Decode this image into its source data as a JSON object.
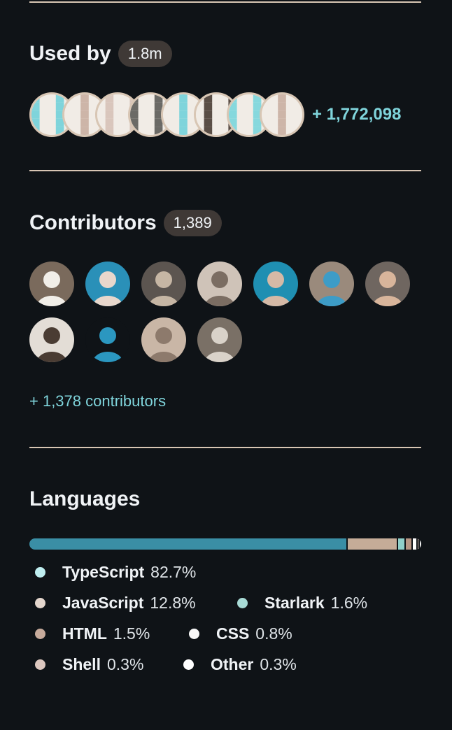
{
  "used_by": {
    "title": "Used by",
    "count": "1.8m",
    "more": "+ 1,772,098",
    "avatars": [
      {
        "fg": "#7fd4db"
      },
      {
        "fg": "#cdb5a8"
      },
      {
        "fg": "#d9c6bc"
      },
      {
        "fg": "#6b6a66"
      },
      {
        "fg": "#7fd4db"
      },
      {
        "fg": "#5a4e46"
      },
      {
        "fg": "#86d8dd"
      },
      {
        "fg": "#cdb5a8"
      }
    ]
  },
  "contributors": {
    "title": "Contributors",
    "count": "1,389",
    "more": "+ 1,378 contributors",
    "avatars": [
      {
        "bg": "#7a6a5c",
        "fg": "#f1eee8"
      },
      {
        "bg": "#2a90b8",
        "fg": "#e8d7cc"
      },
      {
        "bg": "#5c5550",
        "fg": "#c6b6a4"
      },
      {
        "bg": "#cfc3b8",
        "fg": "#7b6d62"
      },
      {
        "bg": "#1f8fb2",
        "fg": "#d5b9a6"
      },
      {
        "bg": "#9a8a7c",
        "fg": "#3d9cc7"
      },
      {
        "bg": "#6f6660",
        "fg": "#d8b59b"
      },
      {
        "bg": "#e3ddd6",
        "fg": "#4a3c33"
      },
      {
        "bg": "#0f1317",
        "fg": "#2b97c0"
      },
      {
        "bg": "#c9b6a6",
        "fg": "#8d7a6c"
      },
      {
        "bg": "#7a7066",
        "fg": "#d9d2c9"
      }
    ]
  },
  "languages": {
    "title": "Languages",
    "items": [
      {
        "name": "TypeScript",
        "pct": "82.7%",
        "value": 82.7,
        "bar_color": "#3a8ea5",
        "dot_color": "#bfeef0"
      },
      {
        "name": "JavaScript",
        "pct": "12.8%",
        "value": 12.8,
        "bar_color": "#c5ac98",
        "dot_color": "#e4d6cd"
      },
      {
        "name": "Starlark",
        "pct": "1.6%",
        "value": 1.6,
        "bar_color": "#8fcfc9",
        "dot_color": "#a8dbd6"
      },
      {
        "name": "HTML",
        "pct": "1.5%",
        "value": 1.5,
        "bar_color": "#b89684",
        "dot_color": "#c7ab9c"
      },
      {
        "name": "CSS",
        "pct": "0.8%",
        "value": 0.8,
        "bar_color": "#ffffff",
        "dot_color": "#f7f7f7"
      },
      {
        "name": "Shell",
        "pct": "0.3%",
        "value": 0.3,
        "bar_color": "#d9c2b8",
        "dot_color": "#dcc7bf"
      },
      {
        "name": "Other",
        "pct": "0.3%",
        "value": 0.3,
        "bar_color": "#f2f2f2",
        "dot_color": "#ffffff"
      }
    ]
  }
}
